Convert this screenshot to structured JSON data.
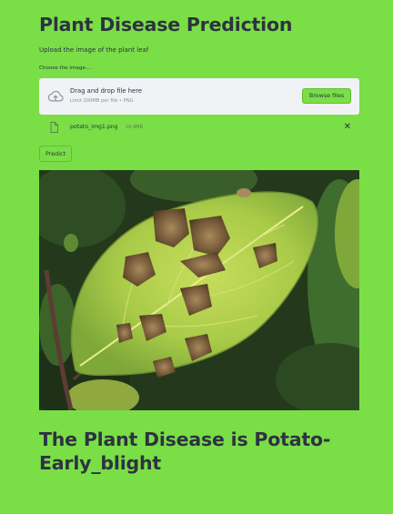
{
  "app": {
    "title": "Plant Disease Prediction",
    "subtitle": "Upload the image of the plant leaf"
  },
  "uploader": {
    "label": "Choose the image....",
    "drop_text": "Drag and drop file here",
    "limit_text": "Limit 200MB per file • PNG",
    "browse_label": "Browse files",
    "icon": "cloud-upload-icon"
  },
  "uploaded_file": {
    "name": "potato_img1.png",
    "size": "18.4MB",
    "icon": "file-icon",
    "remove_icon": "close-icon"
  },
  "predict_button": {
    "label": "Predict"
  },
  "result": {
    "text": "The Plant Disease is Potato-Early_blight"
  },
  "colors": {
    "background": "#7ade47",
    "dropzone": "#f0f2f6",
    "text": "#2d3340"
  }
}
